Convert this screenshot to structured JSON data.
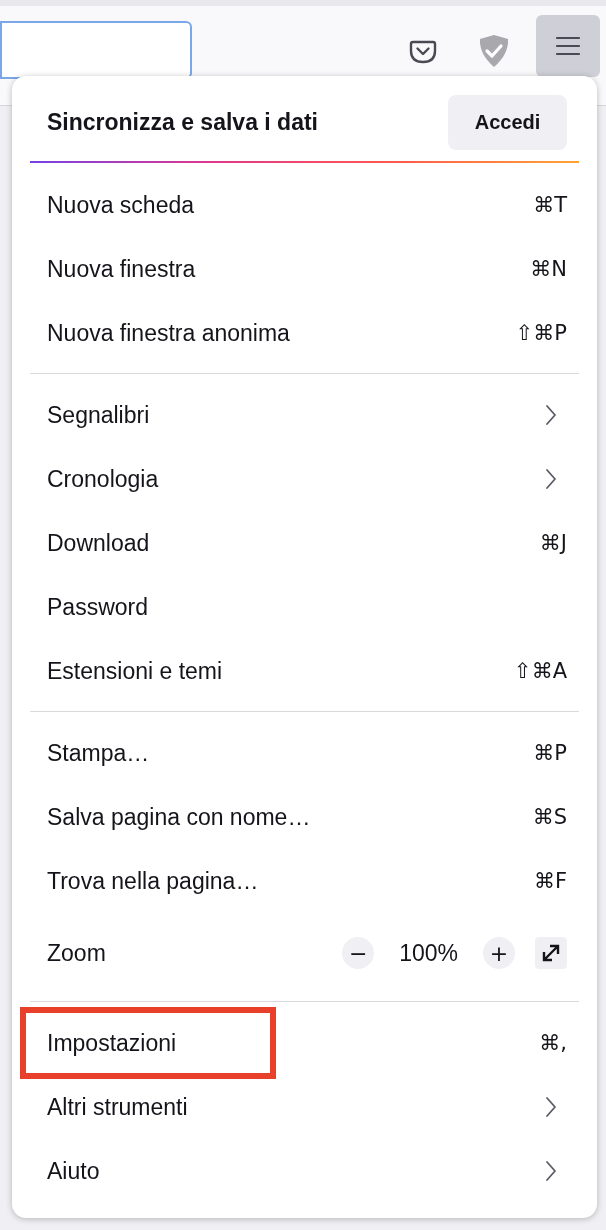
{
  "toolbar": {
    "url_field": {
      "focused": true
    },
    "menu_button": {
      "pressed": true
    }
  },
  "menu": {
    "header": {
      "title": "Sincronizza e salva i dati",
      "button": "Accedi"
    },
    "sections": [
      [
        {
          "kind": "shortcut",
          "label": "Nuova scheda",
          "shortcut": "⌘T"
        },
        {
          "kind": "shortcut",
          "label": "Nuova finestra",
          "shortcut": "⌘N"
        },
        {
          "kind": "shortcut",
          "label": "Nuova finestra anonima",
          "shortcut": "⇧⌘P"
        }
      ],
      [
        {
          "kind": "submenu",
          "label": "Segnalibri"
        },
        {
          "kind": "submenu",
          "label": "Cronologia"
        },
        {
          "kind": "shortcut",
          "label": "Download",
          "shortcut": "⌘J"
        },
        {
          "kind": "plain",
          "label": "Password"
        },
        {
          "kind": "shortcut",
          "label": "Estensioni e temi",
          "shortcut": "⇧⌘A"
        }
      ],
      [
        {
          "kind": "shortcut",
          "label": "Stampa…",
          "shortcut": "⌘P"
        },
        {
          "kind": "shortcut",
          "label": "Salva pagina con nome…",
          "shortcut": "⌘S"
        },
        {
          "kind": "shortcut",
          "label": "Trova nella pagina…",
          "shortcut": "⌘F"
        },
        {
          "kind": "zoom",
          "label": "Zoom",
          "minus": "−",
          "value": "100%",
          "plus": "+"
        }
      ],
      [
        {
          "kind": "shortcut",
          "label": "Impostazioni",
          "shortcut": "⌘,",
          "highlighted": true
        },
        {
          "kind": "submenu",
          "label": "Altri strumenti"
        },
        {
          "kind": "submenu",
          "label": "Aiuto"
        }
      ]
    ]
  }
}
